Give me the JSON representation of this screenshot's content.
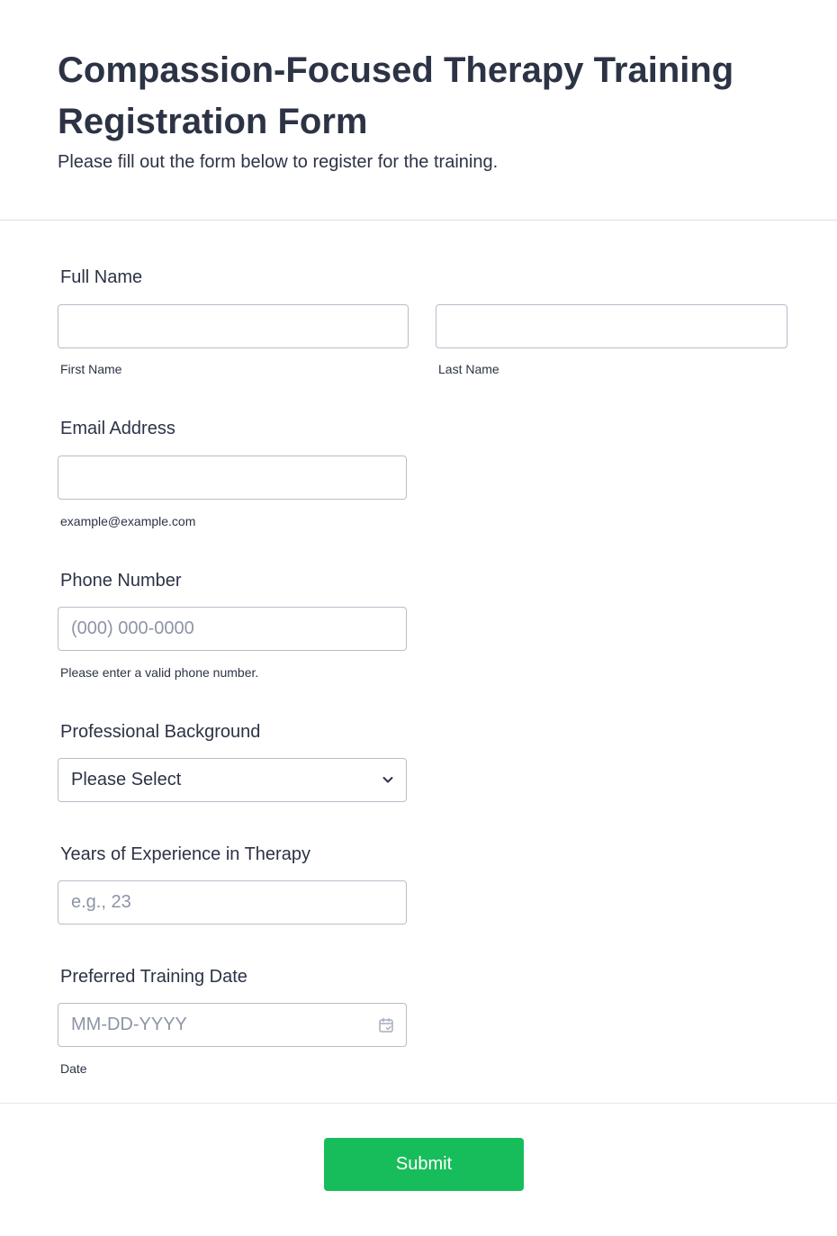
{
  "header": {
    "title": "Compassion-Focused Therapy Training Registration Form",
    "subtitle": "Please fill out the form below to register for the training."
  },
  "full_name": {
    "label": "Full Name",
    "first": {
      "value": "",
      "sublabel": "First Name"
    },
    "last": {
      "value": "",
      "sublabel": "Last Name"
    }
  },
  "email": {
    "label": "Email Address",
    "value": "",
    "sublabel": "example@example.com"
  },
  "phone": {
    "label": "Phone Number",
    "value": "",
    "placeholder": "(000) 000-0000",
    "sublabel": "Please enter a valid phone number."
  },
  "background": {
    "label": "Professional Background",
    "selected": "Please Select",
    "icon": "chevron-down-icon"
  },
  "experience": {
    "label": "Years of Experience in Therapy",
    "value": "",
    "placeholder": "e.g., 23"
  },
  "training_date": {
    "label": "Preferred Training Date",
    "value": "",
    "placeholder": "MM-DD-YYYY",
    "sublabel": "Date",
    "icon": "calendar-icon"
  },
  "submit": {
    "label": "Submit"
  },
  "colors": {
    "accent": "#18bd5b",
    "text": "#2c3345",
    "border": "#b8bdc9",
    "placeholder": "#8d94a5"
  }
}
